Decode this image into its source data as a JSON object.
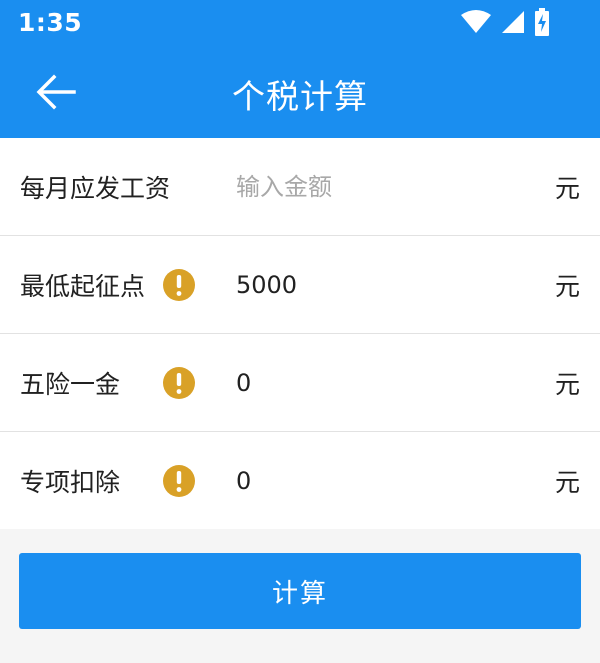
{
  "status_bar": {
    "time": "1:35",
    "icons": [
      "wifi-icon",
      "cell-signal-icon",
      "battery-charging-icon"
    ]
  },
  "app_bar": {
    "title": "个税计算",
    "back_icon": "arrow-left-icon"
  },
  "form": {
    "monthly_salary": {
      "label": "每月应发工资",
      "value": "",
      "placeholder": "输入金额",
      "unit": "元"
    },
    "threshold": {
      "label": "最低起征点",
      "value": "5000",
      "placeholder": "",
      "unit": "元",
      "info_icon": "exclamation-circle-icon"
    },
    "social_insurance": {
      "label": "五险一金",
      "value": "0",
      "placeholder": "",
      "unit": "元",
      "info_icon": "exclamation-circle-icon"
    },
    "special_deduction": {
      "label": "专项扣除",
      "value": "0",
      "placeholder": "",
      "unit": "元",
      "info_icon": "exclamation-circle-icon"
    }
  },
  "calculate_button": {
    "label": "计算"
  },
  "colors": {
    "primary": "#1a8ef0",
    "warning_icon": "#d9a127",
    "divider": "#e2e2e2",
    "placeholder": "#a8a8a8"
  }
}
